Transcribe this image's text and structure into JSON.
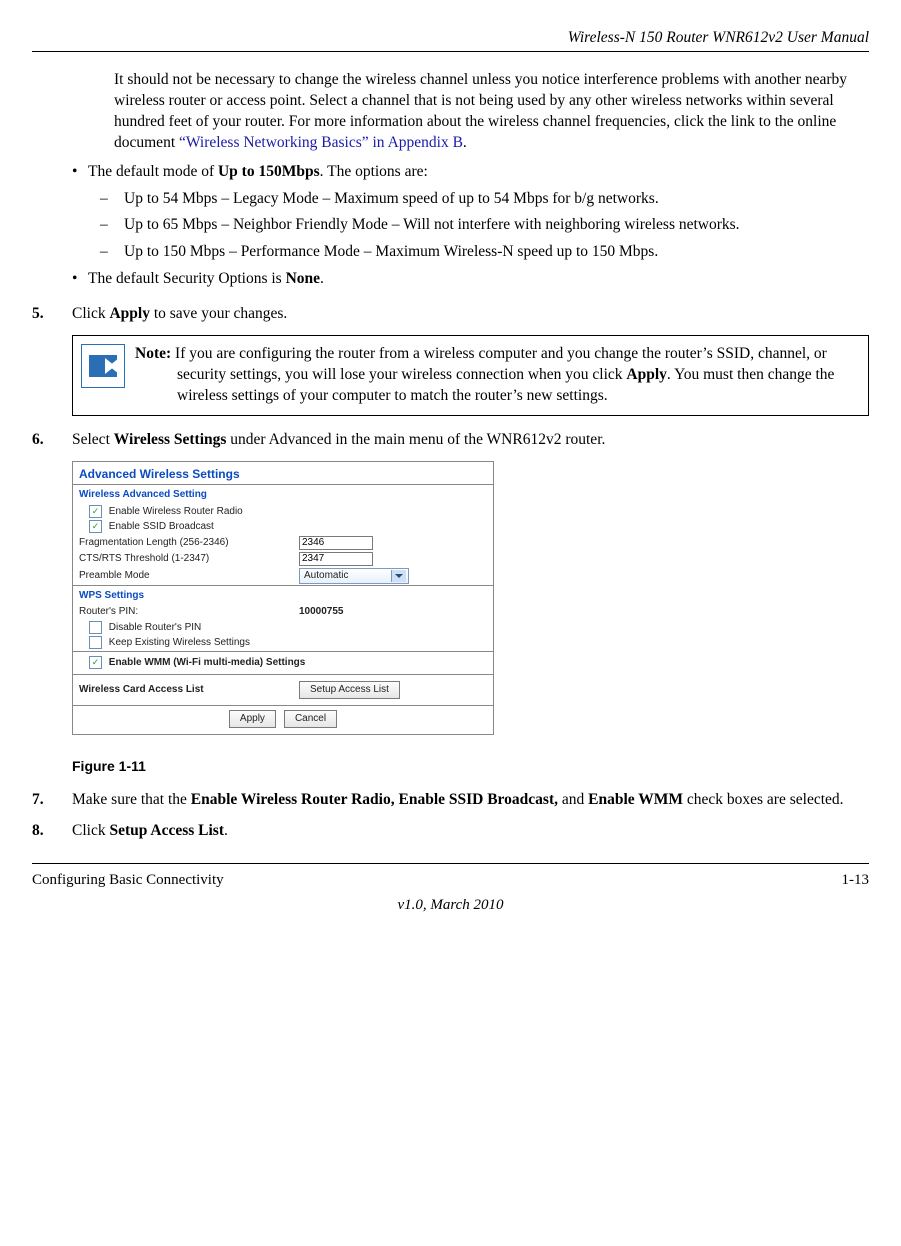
{
  "header": {
    "doc_title": "Wireless-N 150 Router WNR612v2 User Manual"
  },
  "intro": {
    "text_a": "It should not be necessary to change the wireless channel unless you notice interference problems with another nearby wireless router or access point. Select a channel that is not being used by any other wireless networks within several hundred feet of your router. For more information about the wireless channel frequencies, click the link to the online document ",
    "link": "“Wireless Networking Basics” in Appendix B",
    "text_b": "."
  },
  "bullets": {
    "b1_pre": "The default mode of ",
    "b1_bold": "Up to 150Mbps",
    "b1_post": ". The options are:",
    "d1": "Up to 54 Mbps – Legacy Mode – Maximum speed of up to 54 Mbps for b/g networks.",
    "d2": "Up to 65 Mbps – Neighbor Friendly Mode – Will not interfere with neighboring wireless networks.",
    "d3": "Up to 150 Mbps – Performance Mode – Maximum Wireless-N speed up to 150 Mbps.",
    "b2_pre": "The default Security Options is ",
    "b2_bold": "None",
    "b2_post": "."
  },
  "steps": {
    "s5_num": "5.",
    "s5_pre": "Click ",
    "s5_bold": "Apply",
    "s5_post": " to save your changes.",
    "s6_num": "6.",
    "s6_pre": "Select ",
    "s6_bold": "Wireless Settings",
    "s6_post": " under Advanced in the main menu of the WNR612v2 router.",
    "s7_num": "7.",
    "s7_pre": "Make sure that the ",
    "s7_bold": "Enable Wireless Router Radio, Enable SSID Broadcast,",
    "s7_mid": " and ",
    "s7_bold2": "Enable WMM",
    "s7_post": " check boxes are selected.",
    "s8_num": "8.",
    "s8_pre": "Click ",
    "s8_bold": "Setup Access List",
    "s8_post": "."
  },
  "note": {
    "label": "Note:",
    "t1": " If you are configuring the router from a wireless computer and you change the router’s SSID, channel, or security settings, you will lose your wireless connection when you click ",
    "bold": "Apply",
    "t2": ". You must then change the wireless settings of your computer to match the router’s new settings."
  },
  "ui": {
    "title": "Advanced Wireless Settings",
    "sec1": "Wireless Advanced Setting",
    "cb1": "Enable Wireless Router Radio",
    "cb2": "Enable SSID Broadcast",
    "frag_label": "Fragmentation Length (256-2346)",
    "frag_val": "2346",
    "cts_label": "CTS/RTS Threshold (1-2347)",
    "cts_val": "2347",
    "preamble_label": "Preamble Mode",
    "preamble_val": "Automatic",
    "sec2": "WPS Settings",
    "pin_label": "Router's PIN:",
    "pin_val": "10000755",
    "cb3": "Disable Router's PIN",
    "cb4": "Keep Existing Wireless Settings",
    "wmm": "Enable WMM (Wi-Fi multi-media) Settings",
    "acl_label": "Wireless Card Access List",
    "acl_btn": "Setup Access List",
    "apply": "Apply",
    "cancel": "Cancel"
  },
  "figure": {
    "caption": "Figure 1-11"
  },
  "footer": {
    "left": "Configuring Basic Connectivity",
    "right": "1-13",
    "version": "v1.0, March 2010"
  }
}
